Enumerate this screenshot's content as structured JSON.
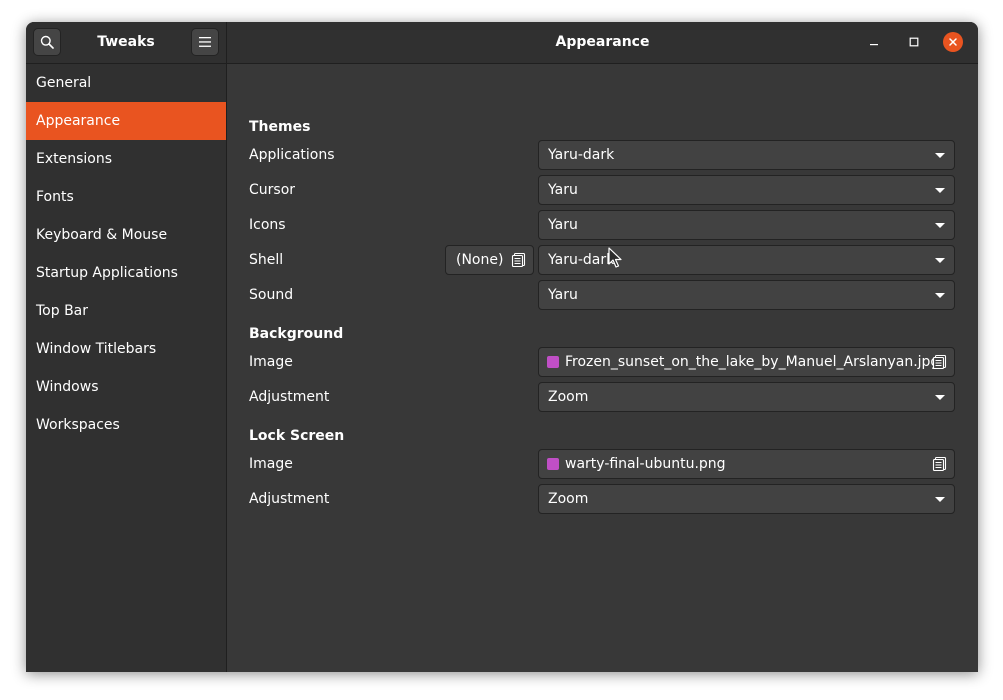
{
  "header": {
    "app_title": "Tweaks",
    "page_title": "Appearance",
    "icons": {
      "search": "search-icon",
      "menu": "hamburger-menu-icon",
      "minimize": "minimize-icon",
      "maximize": "maximize-icon",
      "close": "close-icon"
    }
  },
  "sidebar": {
    "selected_index": 1,
    "items": [
      {
        "label": "General"
      },
      {
        "label": "Appearance"
      },
      {
        "label": "Extensions"
      },
      {
        "label": "Fonts"
      },
      {
        "label": "Keyboard & Mouse"
      },
      {
        "label": "Startup Applications"
      },
      {
        "label": "Top Bar"
      },
      {
        "label": "Window Titlebars"
      },
      {
        "label": "Windows"
      },
      {
        "label": "Workspaces"
      }
    ]
  },
  "themes": {
    "title": "Themes",
    "applications": {
      "label": "Applications",
      "value": "Yaru-dark"
    },
    "cursor": {
      "label": "Cursor",
      "value": "Yaru"
    },
    "icons": {
      "label": "Icons",
      "value": "Yaru"
    },
    "shell": {
      "label": "Shell",
      "value": "Yaru-dark",
      "file_button": "(None)"
    },
    "sound": {
      "label": "Sound",
      "value": "Yaru"
    }
  },
  "background": {
    "title": "Background",
    "image": {
      "label": "Image",
      "value": "Frozen_sunset_on_the_lake_by_Manuel_Arslanyan.jpg"
    },
    "adjustment": {
      "label": "Adjustment",
      "value": "Zoom"
    }
  },
  "lock_screen": {
    "title": "Lock Screen",
    "image": {
      "label": "Image",
      "value": "warty-final-ubuntu.png"
    },
    "adjustment": {
      "label": "Adjustment",
      "value": "Zoom"
    }
  },
  "colors": {
    "accent": "#e95420",
    "window_bg": "#383838",
    "sidebar_bg": "#303030",
    "image_icon": "#c04fc6"
  }
}
